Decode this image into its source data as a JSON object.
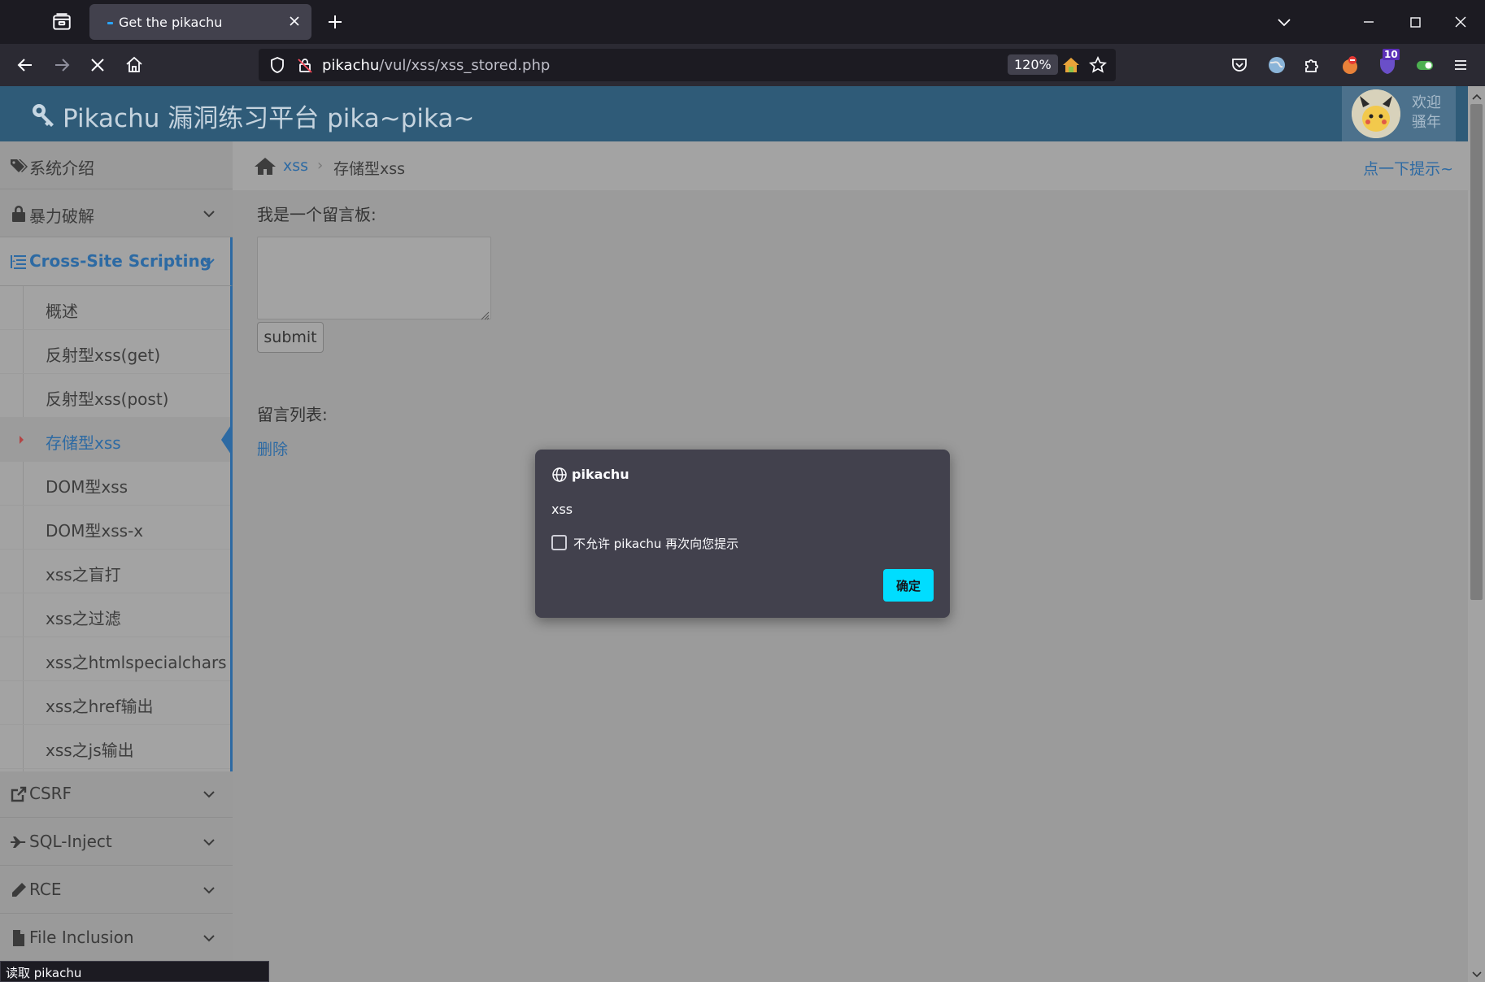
{
  "browser": {
    "tab_title": "Get the pikachu",
    "url_host": "pikachu",
    "url_path": "/vul/xss/xss_stored.php",
    "zoom": "120%",
    "notification_badge": "10"
  },
  "site": {
    "title": "Pikachu 漏洞练习平台 pika~pika~",
    "welcome": "欢迎骚年"
  },
  "sidebar": {
    "items": [
      {
        "label": "系统介绍",
        "icon": "tags-icon"
      },
      {
        "label": "暴力破解",
        "icon": "lock-icon"
      },
      {
        "label": "Cross-Site Scripting",
        "icon": "list-indent-icon"
      },
      {
        "label": "CSRF",
        "icon": "share-icon"
      },
      {
        "label": "SQL-Inject",
        "icon": "plane-icon"
      },
      {
        "label": "RCE",
        "icon": "pencil-icon"
      },
      {
        "label": "File Inclusion",
        "icon": "file-icon"
      }
    ],
    "xss_submenu": [
      "概述",
      "反射型xss(get)",
      "反射型xss(post)",
      "存储型xss",
      "DOM型xss",
      "DOM型xss-x",
      "xss之盲打",
      "xss之过滤",
      "xss之htmlspecialchars",
      "xss之href输出",
      "xss之js输出"
    ]
  },
  "breadcrumb": {
    "link": "xss",
    "current": "存储型xss",
    "hint": "点一下提示~"
  },
  "main": {
    "board_label": "我是一个留言板:",
    "textarea_value": "",
    "submit_label": "submit",
    "list_label": "留言列表:",
    "delete_label": "删除"
  },
  "dialog": {
    "origin": "pikachu",
    "message": "xss",
    "checkbox_label": "不允许 pikachu 再次向您提示",
    "ok_label": "确定"
  },
  "statusbar": {
    "text": "读取 pikachu"
  },
  "colors": {
    "accent": "#2d6aa3",
    "header": "#2f5b78",
    "dialog_ok": "#00ddff"
  }
}
